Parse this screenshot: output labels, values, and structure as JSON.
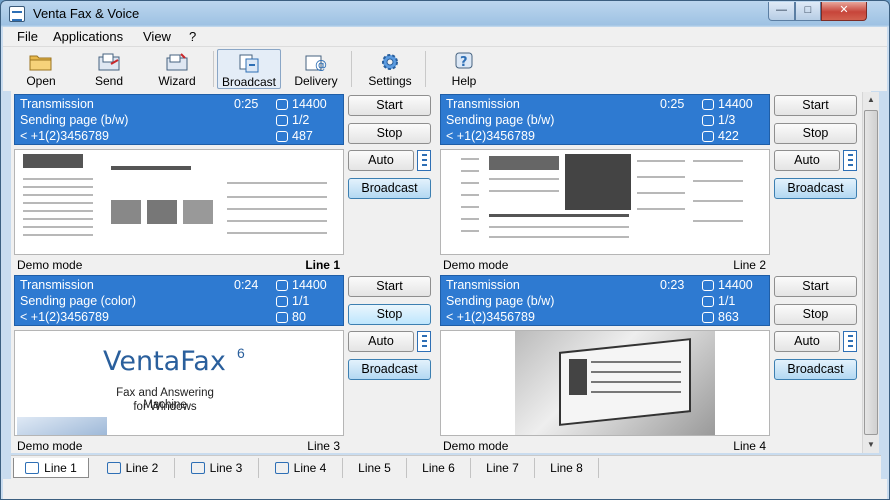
{
  "window": {
    "title": "Venta Fax & Voice",
    "controls": {
      "minimize": "—",
      "maximize": "□",
      "close": "✕"
    }
  },
  "menu": {
    "items": [
      "File",
      "Applications",
      "View",
      "?"
    ]
  },
  "toolbar": {
    "buttons": [
      {
        "label": "Open",
        "icon": "folder-icon"
      },
      {
        "label": "Send",
        "icon": "send-icon"
      },
      {
        "label": "Wizard",
        "icon": "wizard-icon"
      },
      {
        "label": "Broadcast",
        "icon": "broadcast-icon"
      },
      {
        "label": "Delivery",
        "icon": "delivery-icon"
      },
      {
        "label": "Settings",
        "icon": "gear-icon"
      },
      {
        "label": "Help",
        "icon": "help-icon"
      }
    ]
  },
  "panels": [
    {
      "state": "Transmission",
      "time": "0:25",
      "speed": "14400",
      "page_label": "Sending page (b/w)",
      "pages": "1/2",
      "number": "< +1(2)3456789",
      "bytes": "487",
      "mode": "Demo mode",
      "line": "Line 1",
      "preview": "newspaper"
    },
    {
      "state": "Transmission",
      "time": "0:25",
      "speed": "14400",
      "page_label": "Sending page (b/w)",
      "pages": "1/3",
      "number": "< +1(2)3456789",
      "bytes": "422",
      "mode": "Demo mode",
      "line": "Line 2",
      "preview": "newspaper"
    },
    {
      "state": "Transmission",
      "time": "0:24",
      "speed": "14400",
      "page_label": "Sending page (color)",
      "pages": "1/1",
      "number": "< +1(2)3456789",
      "bytes": "80",
      "mode": "Demo mode",
      "line": "Line 3",
      "preview": "logo"
    },
    {
      "state": "Transmission",
      "time": "0:23",
      "speed": "14400",
      "page_label": "Sending page (b/w)",
      "pages": "1/1",
      "number": "< +1(2)3456789",
      "bytes": "863",
      "mode": "Demo mode",
      "line": "Line 4",
      "preview": "screenshot"
    }
  ],
  "panel_buttons": {
    "start": "Start",
    "stop": "Stop",
    "auto": "Auto",
    "broadcast": "Broadcast"
  },
  "logo": {
    "title": "VentaFax",
    "version": "6",
    "subtitle1": "Fax and Answering Machine",
    "subtitle2": "for Windows"
  },
  "tabs": [
    "Line 1",
    "Line 2",
    "Line 3",
    "Line 4",
    "Line 5",
    "Line 6",
    "Line 7",
    "Line 8"
  ],
  "colors": {
    "panel_header": "#2e7ad1",
    "accent": "#3c7fb1"
  }
}
